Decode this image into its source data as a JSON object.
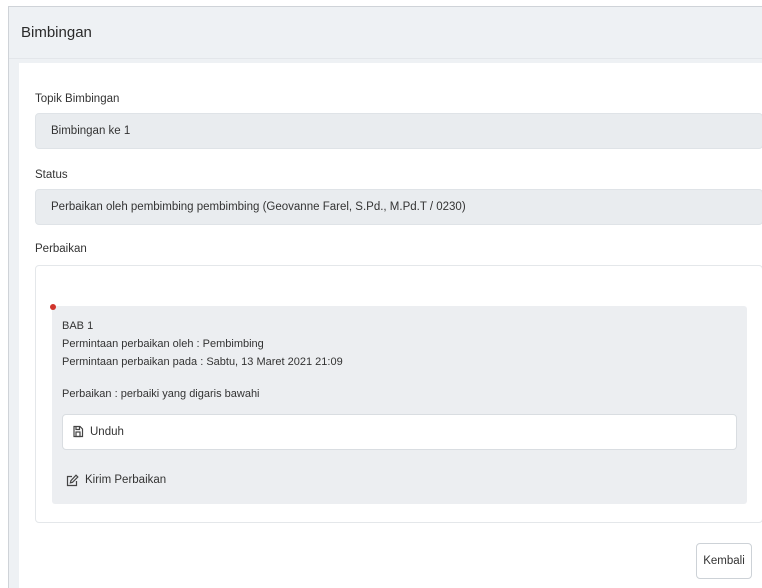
{
  "header": {
    "title": "Bimbingan"
  },
  "form": {
    "topik_label": "Topik Bimbingan",
    "topik_value": "Bimbingan ke 1",
    "status_label": "Status",
    "status_value": "Perbaikan oleh pembimbing pembimbing  (Geovanne Farel, S.Pd., M.Pd.T / 0230)",
    "perbaikan_label": "Perbaikan"
  },
  "perbaikan_item": {
    "bab": "BAB 1",
    "requested_by": "Permintaan perbaikan oleh : Pembimbing",
    "requested_at": "Permintaan perbaikan pada : Sabtu, 13 Maret 2021 21:09",
    "note": "Perbaikan : perbaiki yang digaris bawahi",
    "download_label": "Unduh",
    "send_label": "Kirim Perbaikan"
  },
  "actions": {
    "back_label": "Kembali"
  },
  "icons": {
    "download": "file-icon",
    "send": "edit-icon"
  },
  "colors": {
    "status_dot": "#d0342c"
  }
}
